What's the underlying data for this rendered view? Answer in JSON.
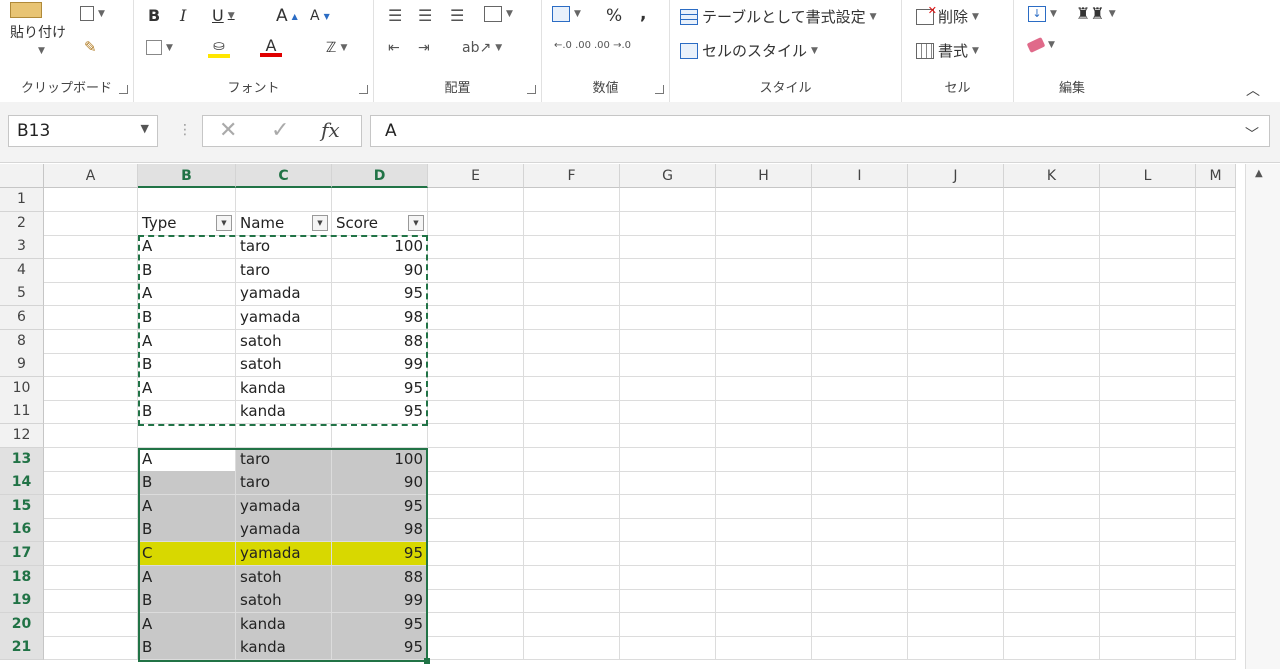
{
  "ribbon": {
    "clipboard": {
      "label": "クリップボード",
      "paste": "貼り付け"
    },
    "font": {
      "label": "フォント",
      "bold": "B",
      "italic": "I",
      "underline": "U",
      "grow": "A",
      "shrink": "A",
      "fill_color": "#ffe600",
      "font_color": "#e00000",
      "font_letter": "A"
    },
    "alignment": {
      "label": "配置"
    },
    "number": {
      "label": "数値",
      "percent": "%",
      "comma": ","
    },
    "styles": {
      "label": "スタイル",
      "format_table": "テーブルとして書式設定",
      "cell_styles": "セルのスタイル"
    },
    "cells": {
      "label": "セル",
      "delete": "削除",
      "format": "書式"
    },
    "editing": {
      "label": "編集"
    }
  },
  "formula_bar": {
    "name_box": "B13",
    "fx": "fx",
    "value": "A"
  },
  "columns": [
    "A",
    "B",
    "C",
    "D",
    "E",
    "F",
    "G",
    "H",
    "I",
    "J",
    "K",
    "L",
    "M"
  ],
  "rows": [
    "1",
    "2",
    "3",
    "4",
    "5",
    "6",
    "8",
    "9",
    "10",
    "11",
    "12",
    "13",
    "14",
    "15",
    "16",
    "17",
    "18",
    "19",
    "20",
    "21"
  ],
  "table_top": {
    "headers": [
      "Type",
      "Name",
      "Score"
    ],
    "rows": [
      [
        "A",
        "taro",
        "100"
      ],
      [
        "B",
        "taro",
        "90"
      ],
      [
        "A",
        "yamada",
        "95"
      ],
      [
        "B",
        "yamada",
        "98"
      ],
      [
        "A",
        "satoh",
        "88"
      ],
      [
        "B",
        "satoh",
        "99"
      ],
      [
        "A",
        "kanda",
        "95"
      ],
      [
        "B",
        "kanda",
        "95"
      ]
    ]
  },
  "table_bottom": {
    "rows": [
      [
        "A",
        "taro",
        "100"
      ],
      [
        "B",
        "taro",
        "90"
      ],
      [
        "A",
        "yamada",
        "95"
      ],
      [
        "B",
        "yamada",
        "98"
      ],
      [
        "C",
        "yamada",
        "95"
      ],
      [
        "A",
        "satoh",
        "88"
      ],
      [
        "B",
        "satoh",
        "99"
      ],
      [
        "A",
        "kanda",
        "95"
      ],
      [
        "B",
        "kanda",
        "95"
      ]
    ]
  },
  "colors": {
    "accent": "#217346",
    "highlight": "#d8d800"
  }
}
